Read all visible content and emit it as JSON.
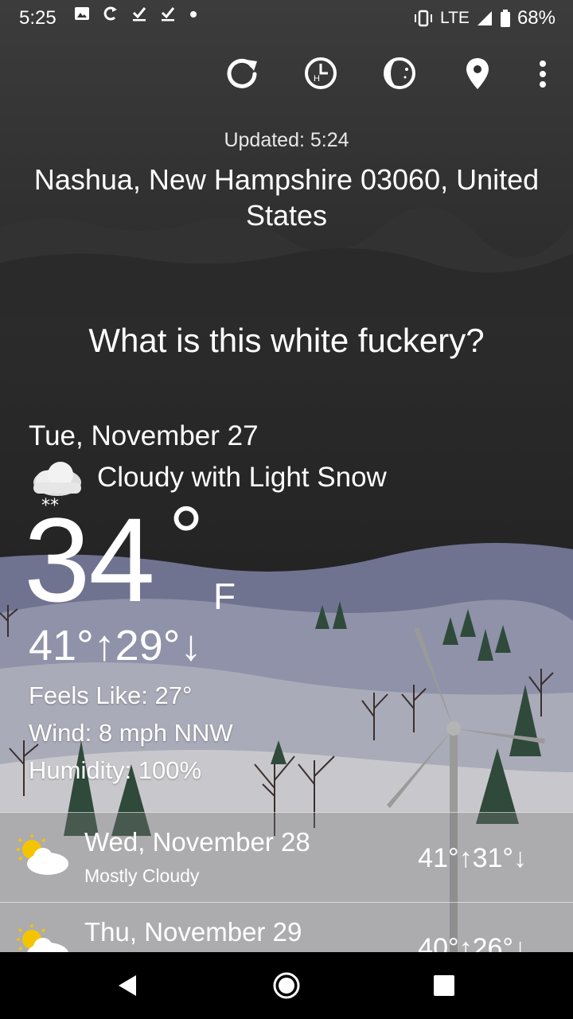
{
  "status_bar": {
    "time": "5:25",
    "network": "LTE",
    "battery": "68%",
    "icons": [
      "image-icon",
      "sync-icon",
      "check-download-icon",
      "check-download-icon",
      "dot-icon",
      "vibrate-icon",
      "signal-icon",
      "battery-icon"
    ]
  },
  "toolbar": {
    "icons": [
      "refresh-icon",
      "hourly-icon",
      "moon-phase-icon",
      "location-pin-icon",
      "more-options-icon"
    ]
  },
  "header": {
    "updated": "Updated: 5:24",
    "location": "Nashua, New Hampshire 03060, United States"
  },
  "headline": "What is this white fuckery?",
  "current": {
    "date": "Tue, November 27",
    "condition": "Cloudy with Light Snow",
    "temperature": "34",
    "degree": "°",
    "unit": "F",
    "hi_lo": "41°↑29°↓",
    "feels_like": "Feels Like: 27°",
    "wind": "Wind: 8 mph NNW",
    "humidity": "Humidity: 100%"
  },
  "forecast": [
    {
      "date": "Wed, November 28",
      "condition": "Mostly Cloudy",
      "temps": "41°↑31°↓",
      "icon": "partly-sunny-icon"
    },
    {
      "date": "Thu, November 29",
      "condition": "",
      "temps": "40°↑26°↓",
      "icon": "partly-sunny-icon"
    }
  ],
  "colors": {
    "sky_top": "#3a3a3a",
    "sky_bottom": "#262626",
    "hills": "#7b7e97",
    "snow": "#c9c9cc",
    "tree": "#2e4a3a"
  }
}
